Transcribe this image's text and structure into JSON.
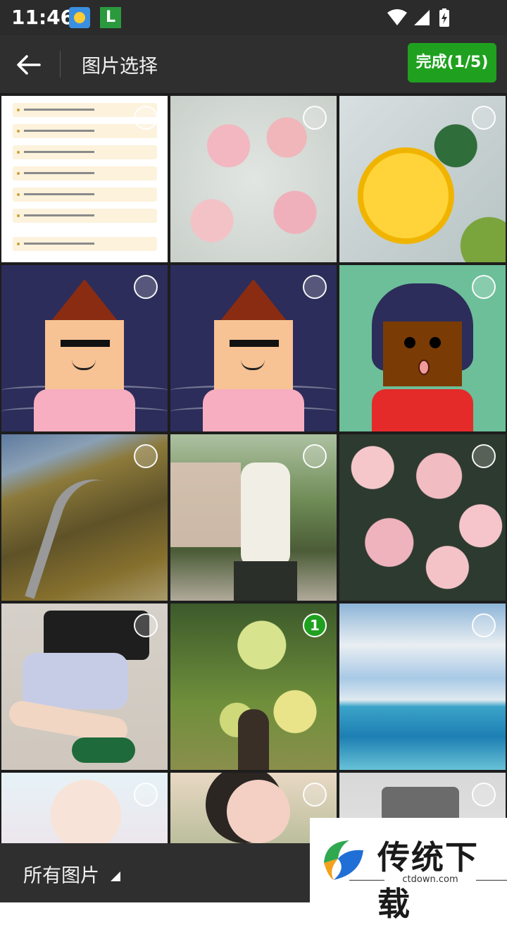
{
  "status_bar": {
    "time": "11:46",
    "app_icon_label": "L",
    "icons": [
      "weather-icon",
      "app-notification-icon",
      "wifi-icon",
      "signal-icon",
      "battery-charging-icon"
    ]
  },
  "header": {
    "back_icon": "arrow-left-icon",
    "title": "图片选择",
    "done_button": "完成(1/5)"
  },
  "grid": {
    "columns": 3,
    "tiles": [
      {
        "kind": "document-screenshot",
        "selected": false
      },
      {
        "kind": "pink-roses-in-water",
        "selected": false
      },
      {
        "kind": "lemon-mint-kiwi",
        "selected": false
      },
      {
        "kind": "cartoon-avatar-boy",
        "selected": false
      },
      {
        "kind": "cartoon-avatar-boy",
        "selected": false
      },
      {
        "kind": "cartoon-avatar-girl",
        "selected": false
      },
      {
        "kind": "mountain-road",
        "selected": false
      },
      {
        "kind": "girl-outdoors",
        "selected": false
      },
      {
        "kind": "rose-bouquet",
        "selected": false
      },
      {
        "kind": "legs-green-socks",
        "selected": false
      },
      {
        "kind": "jellyfish-forest",
        "selected": true,
        "order": "1"
      },
      {
        "kind": "sea-clouds",
        "selected": false
      },
      {
        "kind": "anime-character",
        "selected": false
      },
      {
        "kind": "anime-girl",
        "selected": false
      },
      {
        "kind": "meter-device",
        "selected": false
      }
    ]
  },
  "bottom_bar": {
    "album_label": "所有图片",
    "dropdown_icon": "triangle-indicator-icon"
  },
  "watermark": {
    "brand": "传统下载",
    "url": "ctdown.com"
  },
  "colors": {
    "accent": "#1fa11f",
    "bar_bg": "#2f2f2f",
    "status_bg": "#2b2b2b"
  }
}
